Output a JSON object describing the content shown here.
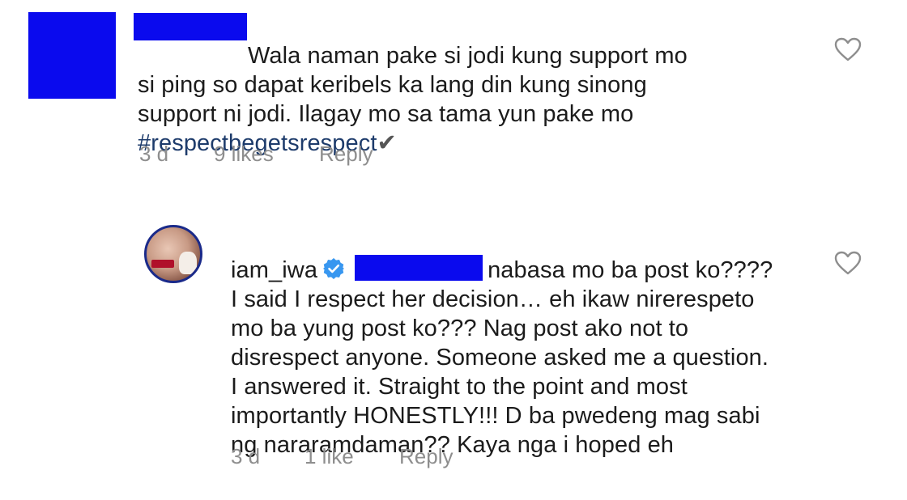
{
  "comments": [
    {
      "text_line1": "Wala naman pake si jodi kung support mo",
      "text_rest": "si ping so dapat keribels ka lang din kung sinong\nsupport ni jodi. Ilagay mo sa tama yun pake mo\n",
      "hashtag": "#respectbegetsrespect",
      "check_glyph": "✔",
      "time": "3 d",
      "likes": "9 likes",
      "reply_label": "Reply",
      "heart_icon": "heart-outline-icon"
    },
    {
      "username": "iam_iwa",
      "verified_icon": "verified-badge-icon",
      "text_line1": "nabasa mo ba post ko????",
      "text_rest": "I said I respect her decision… eh ikaw nirerespeto\nmo ba yung post ko??? Nag post ako not to\ndisrespect anyone. Someone asked me a question.\nI answered it. Straight to the point and most\nimportantly HONESTLY!!! D ba pwedeng mag sabi\nng nararamdaman?? Kaya nga i hoped eh",
      "time": "3 d",
      "likes": "1 like",
      "reply_label": "Reply",
      "heart_icon": "heart-outline-icon"
    }
  ],
  "colors": {
    "redaction": "#0a0aee",
    "hashtag": "#1d3b6b",
    "meta": "#8e8e8e",
    "verified": "#3897f0"
  }
}
